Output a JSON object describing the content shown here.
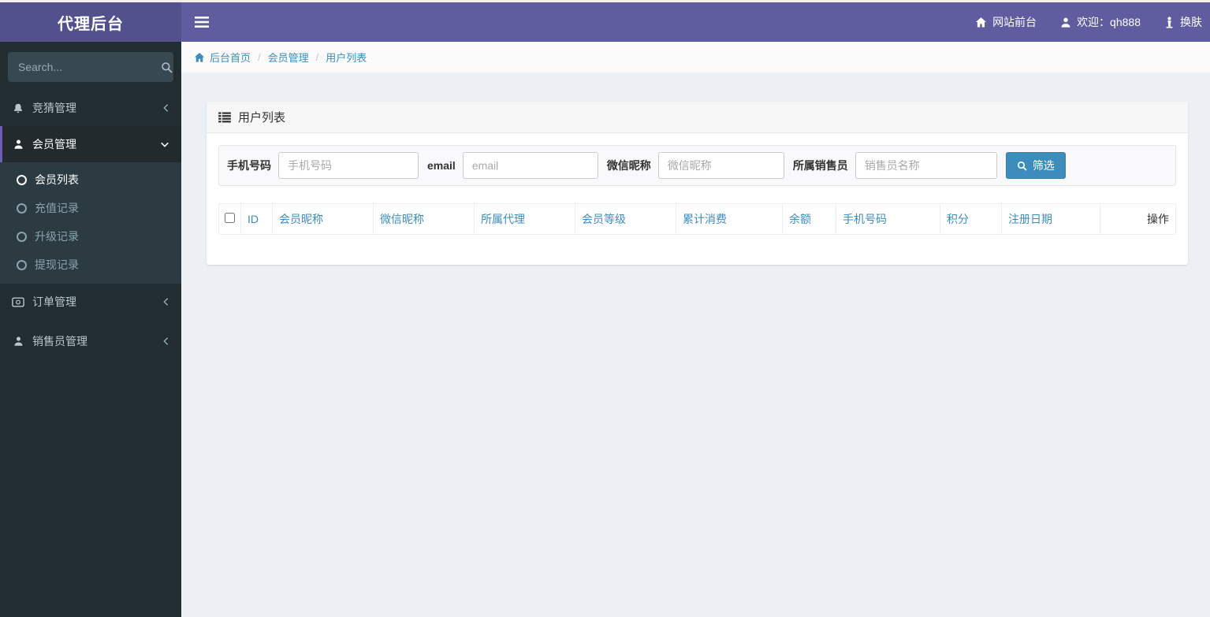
{
  "app": {
    "title": "代理后台"
  },
  "header": {
    "nav": [
      {
        "label": "网站前台",
        "icon": "home-icon"
      },
      {
        "label": "欢迎：qh888",
        "icon": "user-icon"
      },
      {
        "label": "换肤",
        "icon": "skin-icon"
      }
    ]
  },
  "sidebar": {
    "search_placeholder": "Search...",
    "search_value": "",
    "items": [
      {
        "label": "竞猜管理",
        "icon": "bell-icon",
        "state": "collapsed"
      },
      {
        "label": "会员管理",
        "icon": "user-icon",
        "state": "expanded",
        "active": true,
        "children": [
          {
            "label": "会员列表",
            "active": true
          },
          {
            "label": "充值记录",
            "active": false
          },
          {
            "label": "升级记录",
            "active": false
          },
          {
            "label": "提现记录",
            "active": false
          }
        ]
      },
      {
        "label": "订单管理",
        "icon": "money-icon",
        "state": "collapsed"
      },
      {
        "label": "销售员管理",
        "icon": "user-icon",
        "state": "collapsed"
      }
    ]
  },
  "breadcrumb": {
    "separator": "/",
    "items": [
      {
        "label": "后台首页",
        "icon": "home-icon"
      },
      {
        "label": "会员管理"
      },
      {
        "label": "用户列表"
      }
    ]
  },
  "panel": {
    "title": "用户列表",
    "filters": [
      {
        "label": "手机号码",
        "placeholder": "手机号码",
        "value": ""
      },
      {
        "label": "email",
        "placeholder": "email",
        "value": ""
      },
      {
        "label": "微信昵称",
        "placeholder": "微信昵称",
        "value": ""
      },
      {
        "label": "所属销售员",
        "placeholder": "销售员名称",
        "value": ""
      }
    ],
    "filter_button": "筛选",
    "table": {
      "columns": [
        "ID",
        "会员昵称",
        "微信昵称",
        "所属代理",
        "会员等级",
        "累计消费",
        "余额",
        "手机号码",
        "积分",
        "注册日期",
        "操作"
      ],
      "rows": []
    }
  },
  "colors": {
    "header_purple": "#5f5ca0",
    "logo_purple": "#53508e",
    "sidebar_dark": "#222d32",
    "submenu_dark": "#2c3b41",
    "active_border_purple": "#6a5fb5",
    "link_blue": "#3c8dbc",
    "button_blue": "#3c8dbc",
    "content_bg": "#ecf0f5"
  }
}
